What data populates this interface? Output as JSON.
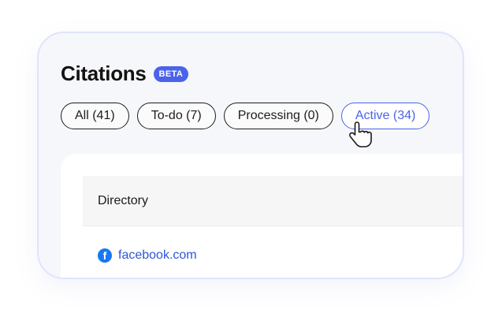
{
  "header": {
    "title": "Citations",
    "badge": "BETA"
  },
  "filters": [
    {
      "label": "All (41)",
      "active": false
    },
    {
      "label": "To-do (7)",
      "active": false
    },
    {
      "label": "Processing (0)",
      "active": false
    },
    {
      "label": "Active (34)",
      "active": true
    }
  ],
  "table": {
    "columns": [
      "Directory"
    ],
    "rows": [
      {
        "directory": "facebook.com",
        "icon": "facebook-icon"
      }
    ]
  },
  "colors": {
    "accent": "#4b63ea",
    "link": "#2f55d8",
    "facebook": "#1877f2"
  }
}
